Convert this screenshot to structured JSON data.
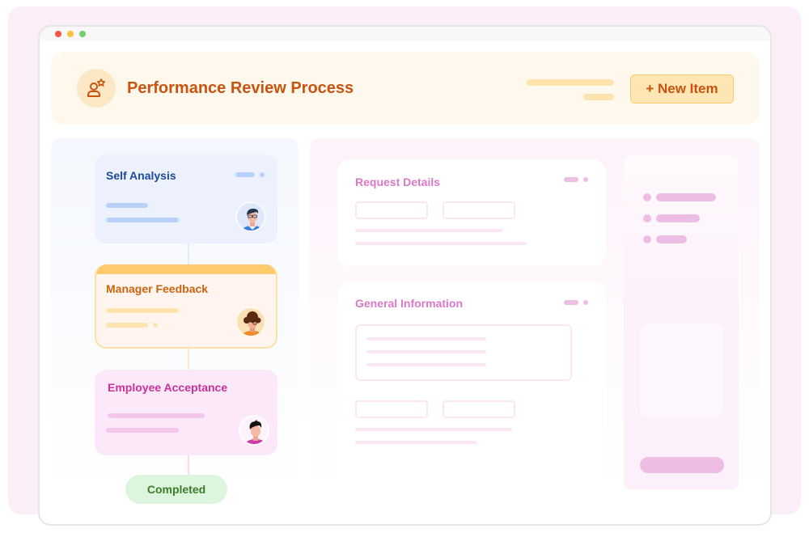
{
  "window": {
    "controls": [
      "close",
      "minimize",
      "maximize"
    ]
  },
  "header": {
    "icon": "user-star-icon",
    "title": "Performance Review Process",
    "new_item_label": "+ New Item"
  },
  "workflow": {
    "stages": [
      {
        "title": "Self Analysis",
        "avatar": "man-glasses-avatar"
      },
      {
        "title": "Manager Feedback",
        "avatar": "woman-curly-hair-avatar"
      },
      {
        "title": "Employee Acceptance",
        "avatar": "man-dark-hair-avatar"
      }
    ],
    "status_label": "Completed"
  },
  "details": {
    "request_title": "Request Details",
    "general_title": "General Information"
  },
  "colors": {
    "header_accent": "#c9530f",
    "self_analysis": "#1d4aa0",
    "manager_feedback": "#c9640f",
    "employee_acceptance": "#c8309a",
    "completed": "#3a7d2b",
    "card_title": "#da78c9"
  }
}
